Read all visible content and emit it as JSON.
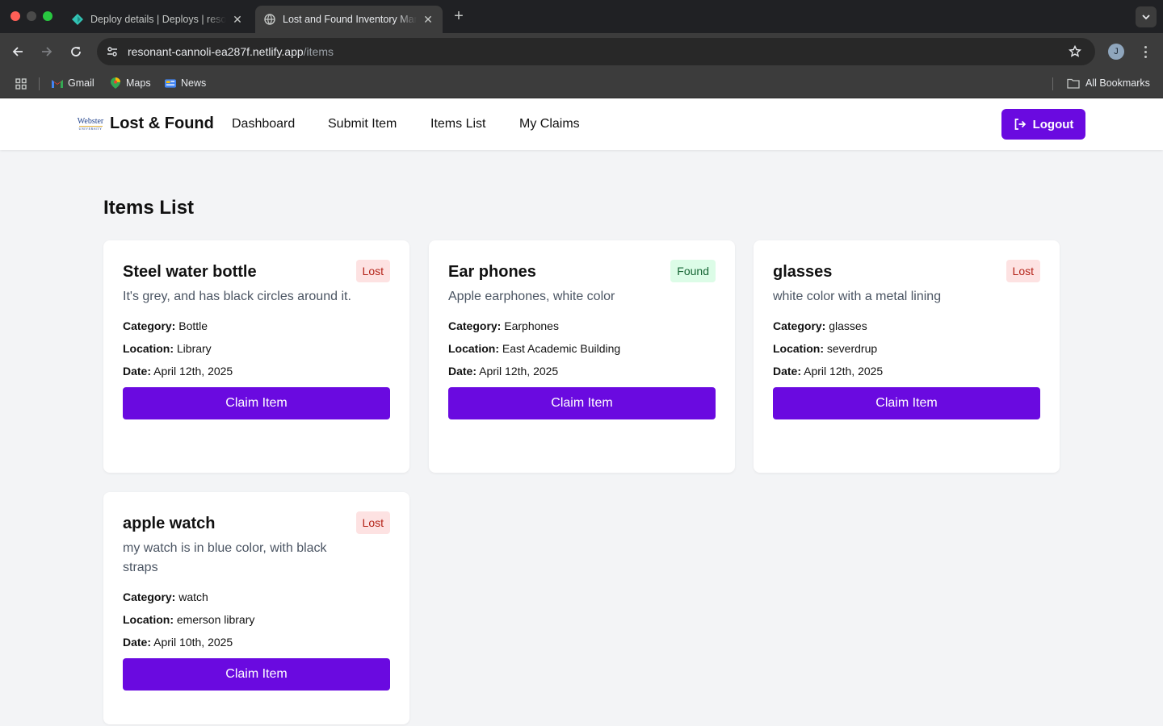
{
  "browser": {
    "tabs": [
      {
        "title": "Deploy details | Deploys | resonant-cannoli",
        "icon": "netlify-icon",
        "active": false
      },
      {
        "title": "Lost and Found Inventory Manager",
        "icon": "globe-icon",
        "active": true
      }
    ],
    "url_host": "resonant-cannoli-ea287f.netlify.app",
    "url_path": "/items",
    "profile_initial": "J",
    "bookmarks": [
      {
        "label": "Gmail",
        "icon": "gmail-icon"
      },
      {
        "label": "Maps",
        "icon": "maps-icon"
      },
      {
        "label": "News",
        "icon": "news-icon"
      }
    ],
    "all_bookmarks": "All Bookmarks"
  },
  "header": {
    "logo_text": "Webster",
    "logo_subtext": "UNIVERSITY",
    "brand": "Lost & Found",
    "nav": [
      "Dashboard",
      "Submit Item",
      "Items List",
      "My Claims"
    ],
    "logout": "Logout"
  },
  "main": {
    "title": "Items List",
    "labels": {
      "category": "Category:",
      "location": "Location:",
      "date": "Date:"
    },
    "claim_label": "Claim Item",
    "items": [
      {
        "name": "Steel water bottle",
        "status": "Lost",
        "description": "It's grey, and has black circles around it.",
        "category": "Bottle",
        "location": "Library",
        "date": "April 12th, 2025"
      },
      {
        "name": "Ear phones",
        "status": "Found",
        "description": "Apple earphones, white color",
        "category": "Earphones",
        "location": "East Academic Building",
        "date": "April 12th, 2025"
      },
      {
        "name": "glasses",
        "status": "Lost",
        "description": "white color with a metal lining",
        "category": "glasses",
        "location": "severdrup",
        "date": "April 12th, 2025"
      },
      {
        "name": "apple watch",
        "status": "Lost",
        "description": "my watch is in blue color, with black straps",
        "category": "watch",
        "location": "emerson library",
        "date": "April 10th, 2025"
      }
    ]
  },
  "colors": {
    "accent": "#6a0ae0",
    "lost_bg": "#fde2e2",
    "lost_text": "#b42318",
    "found_bg": "#dcfce7",
    "found_text": "#166534",
    "page_bg": "#f3f4f6"
  }
}
